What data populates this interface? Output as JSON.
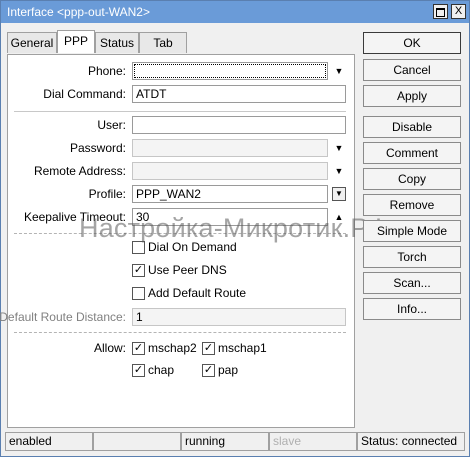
{
  "window": {
    "title": "Interface <ppp-out-WAN2>",
    "max_glyph": "",
    "close_glyph": "X"
  },
  "tabs": [
    {
      "label": "General",
      "active": false
    },
    {
      "label": "PPP",
      "active": true
    },
    {
      "label": "Status",
      "active": false
    },
    {
      "label": "Tab",
      "active": false
    }
  ],
  "form": {
    "phone": {
      "label": "Phone:",
      "value": ""
    },
    "dial_command": {
      "label": "Dial Command:",
      "value": "ATDT"
    },
    "user": {
      "label": "User:",
      "value": ""
    },
    "password": {
      "label": "Password:",
      "value": ""
    },
    "remote_address": {
      "label": "Remote Address:",
      "value": ""
    },
    "profile": {
      "label": "Profile:",
      "value": "PPP_WAN2"
    },
    "keepalive_timeout": {
      "label": "Keepalive Timeout:",
      "value": "30"
    },
    "dial_on_demand": {
      "label": "Dial On Demand",
      "checked": false
    },
    "use_peer_dns": {
      "label": "Use Peer DNS",
      "checked": true
    },
    "add_default_route": {
      "label": "Add Default Route",
      "checked": false
    },
    "default_route_distance": {
      "label": "Default Route Distance:",
      "value": "1"
    },
    "allow": {
      "label": "Allow:",
      "options": [
        {
          "label": "mschap2",
          "checked": true
        },
        {
          "label": "mschap1",
          "checked": true
        },
        {
          "label": "chap",
          "checked": true
        },
        {
          "label": "pap",
          "checked": true
        }
      ]
    }
  },
  "glyphs": {
    "down": "▼",
    "up": "▲",
    "dropdown": "▼",
    "check": "✓"
  },
  "buttons": [
    "OK",
    "Cancel",
    "Apply",
    "Disable",
    "Comment",
    "Copy",
    "Remove",
    "Simple Mode",
    "Torch",
    "Scan...",
    "Info..."
  ],
  "statusbar": {
    "state": "enabled",
    "cell2": "",
    "running": "running",
    "slave": "slave",
    "status": "Status: connected"
  },
  "watermark": "Настройка-Микротик.РФ"
}
